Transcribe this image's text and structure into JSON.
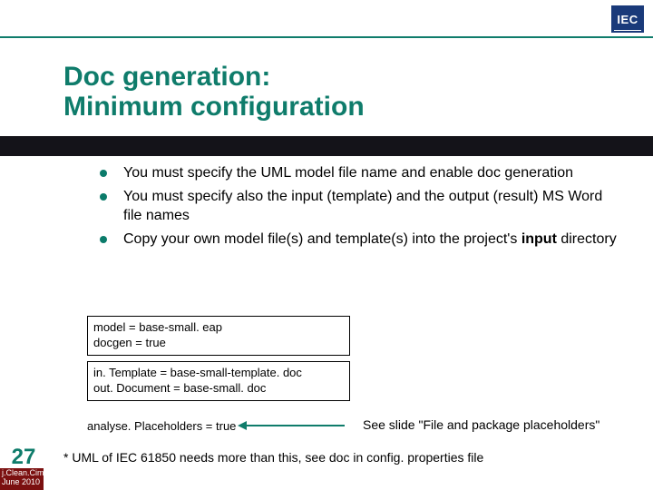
{
  "logo": {
    "text": "IEC"
  },
  "title": {
    "line1": "Doc generation:",
    "line2": "Minimum configuration"
  },
  "bullets": [
    {
      "pre": "You must specify the UML model file name and enable doc generation"
    },
    {
      "pre": "You must specify also the input (template) and the output (result) MS Word file names"
    },
    {
      "pre": "Copy your own model file(s) and template(s) into the project's ",
      "bold": "input",
      "post": " directory"
    }
  ],
  "codeboxes": [
    {
      "l1": "model = base-small. eap",
      "l2": "docgen = true"
    },
    {
      "l1": "in. Template = base-small-template. doc",
      "l2": "out. Document = base-small. doc"
    }
  ],
  "loose_line": "analyse. Placeholders = true",
  "see_also": "See slide \"File and package placeholders\"",
  "footnote": "* UML of IEC 61850 needs more than this, see doc in config. properties file",
  "page_number": "27",
  "footer": {
    "l1": "j.Clean.Cim",
    "l2": "June 2010"
  }
}
